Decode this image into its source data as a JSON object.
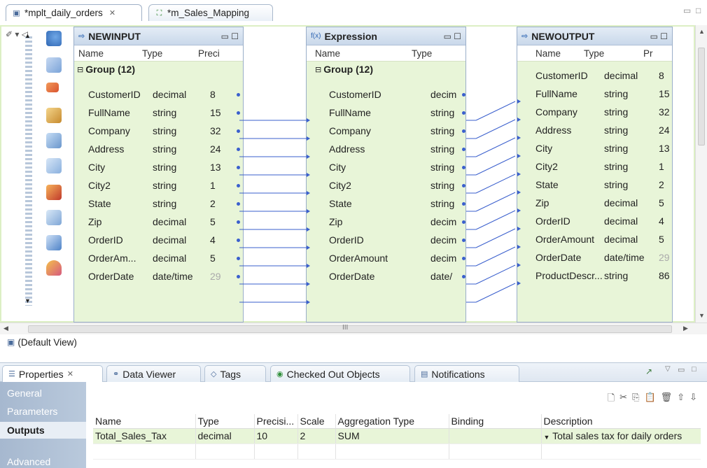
{
  "editor_tabs": [
    {
      "label": "*mplt_daily_orders",
      "active": true
    },
    {
      "label": "*m_Sales_Mapping",
      "active": false
    }
  ],
  "transformations": {
    "input": {
      "title": "NEWINPUT",
      "col_name": "Name",
      "col_type": "Type",
      "col_prec": "Preci",
      "group": "Group (12)",
      "rows": [
        {
          "name": "CustomerID",
          "type": "decimal",
          "prec": "8"
        },
        {
          "name": "FullName",
          "type": "string",
          "prec": "15"
        },
        {
          "name": "Company",
          "type": "string",
          "prec": "32"
        },
        {
          "name": "Address",
          "type": "string",
          "prec": "24"
        },
        {
          "name": "City",
          "type": "string",
          "prec": "13"
        },
        {
          "name": "City2",
          "type": "string",
          "prec": "1"
        },
        {
          "name": "State",
          "type": "string",
          "prec": "2"
        },
        {
          "name": "Zip",
          "type": "decimal",
          "prec": "5"
        },
        {
          "name": "OrderID",
          "type": "decimal",
          "prec": "4"
        },
        {
          "name": "OrderAm...",
          "type": "decimal",
          "prec": "5"
        },
        {
          "name": "OrderDate",
          "type": "date/time",
          "prec": "29"
        }
      ]
    },
    "expression": {
      "title": "Expression",
      "col_name": "Name",
      "col_type": "Type",
      "group": "Group (12)",
      "rows": [
        {
          "name": "CustomerID",
          "type": "decim"
        },
        {
          "name": "FullName",
          "type": "string"
        },
        {
          "name": "Company",
          "type": "string"
        },
        {
          "name": "Address",
          "type": "string"
        },
        {
          "name": "City",
          "type": "string"
        },
        {
          "name": "City2",
          "type": "string"
        },
        {
          "name": "State",
          "type": "string"
        },
        {
          "name": "Zip",
          "type": "decim"
        },
        {
          "name": "OrderID",
          "type": "decim"
        },
        {
          "name": "OrderAmount",
          "type": "decim"
        },
        {
          "name": "OrderDate",
          "type": "date/"
        }
      ]
    },
    "output": {
      "title": "NEWOUTPUT",
      "col_name": "Name",
      "col_type": "Type",
      "col_prec": "Pr",
      "rows": [
        {
          "name": "CustomerID",
          "type": "decimal",
          "prec": "8"
        },
        {
          "name": "FullName",
          "type": "string",
          "prec": "15"
        },
        {
          "name": "Company",
          "type": "string",
          "prec": "32"
        },
        {
          "name": "Address",
          "type": "string",
          "prec": "24"
        },
        {
          "name": "City",
          "type": "string",
          "prec": "13"
        },
        {
          "name": "City2",
          "type": "string",
          "prec": "1"
        },
        {
          "name": "State",
          "type": "string",
          "prec": "2"
        },
        {
          "name": "Zip",
          "type": "decimal",
          "prec": "5"
        },
        {
          "name": "OrderID",
          "type": "decimal",
          "prec": "4"
        },
        {
          "name": "OrderAmount",
          "type": "decimal",
          "prec": "5"
        },
        {
          "name": "OrderDate",
          "type": "date/time",
          "prec": "29"
        },
        {
          "name": "ProductDescr...",
          "type": "string",
          "prec": "86"
        }
      ]
    }
  },
  "scroll_marker": "III",
  "default_view": "(Default View)",
  "bottom_tabs": [
    {
      "label": "Properties",
      "active": true,
      "icon": "properties-icon"
    },
    {
      "label": "Data Viewer",
      "active": false,
      "icon": "data-viewer-icon"
    },
    {
      "label": "Tags",
      "active": false,
      "icon": "tag-icon"
    },
    {
      "label": "Checked Out Objects",
      "active": false,
      "icon": "checked-out-icon"
    },
    {
      "label": "Notifications",
      "active": false,
      "icon": "notification-icon"
    }
  ],
  "side_nav": [
    {
      "label": "General",
      "active": false
    },
    {
      "label": "Parameters",
      "active": false
    },
    {
      "label": "Outputs",
      "active": true
    },
    {
      "label": "Advanced",
      "active": false
    }
  ],
  "outputs_table": {
    "headers": [
      "Name",
      "Type",
      "Precisi...",
      "Scale",
      "Aggregation Type",
      "Binding",
      "Description"
    ],
    "rows": [
      {
        "name": "Total_Sales_Tax",
        "type": "decimal",
        "precision": "10",
        "scale": "2",
        "aggregation": "SUM",
        "binding": "",
        "description": "Total sales tax for daily orders"
      }
    ]
  },
  "colors": {
    "field_bg": "#e8f5d8",
    "port": "#3a5fcd",
    "link": "#3a5fcd",
    "header": "#c9d8ea"
  }
}
